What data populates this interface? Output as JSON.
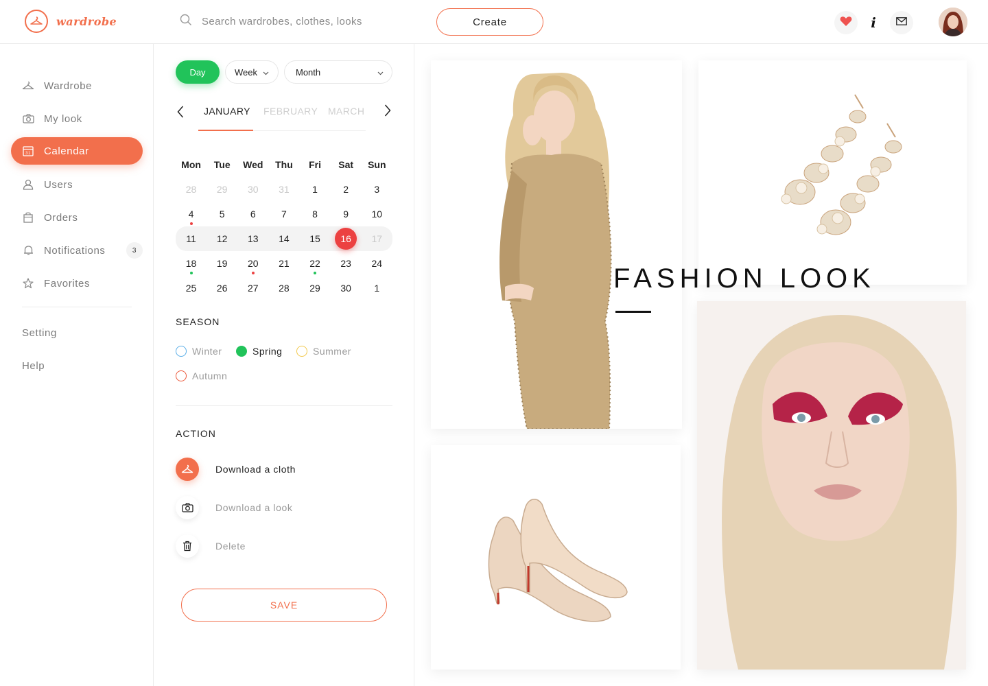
{
  "header": {
    "logo_text": "wardrobe",
    "search_placeholder": "Search wardrobes, clothes, looks",
    "create_label": "Create",
    "icons": [
      "heart-icon",
      "info-icon",
      "mail-icon"
    ]
  },
  "sidebar": {
    "items": [
      {
        "label": "Wardrobe",
        "icon": "hanger-icon"
      },
      {
        "label": "My look",
        "icon": "camera-icon"
      },
      {
        "label": "Calendar",
        "icon": "calendar-icon",
        "active": true
      },
      {
        "label": "Users",
        "icon": "user-icon"
      },
      {
        "label": "Orders",
        "icon": "bag-icon"
      },
      {
        "label": "Notifications",
        "icon": "bell-icon",
        "badge": "3"
      },
      {
        "label": "Favorites",
        "icon": "star-icon"
      }
    ],
    "setting_label": "Setting",
    "help_label": "Help"
  },
  "panel": {
    "view_day": "Day",
    "view_week": "Week",
    "view_month": "Month",
    "months": [
      "JANUARY",
      "FEBRUARY",
      "MARCH"
    ],
    "active_month": "JANUARY",
    "weekdays": [
      "Mon",
      "Tue",
      "Wed",
      "Thu",
      "Fri",
      "Sat",
      "Sun"
    ],
    "weeks": [
      [
        "28",
        "29",
        "30",
        "31",
        "1",
        "2",
        "3"
      ],
      [
        "4",
        "5",
        "6",
        "7",
        "8",
        "9",
        "10"
      ],
      [
        "11",
        "12",
        "13",
        "14",
        "15",
        "16",
        "17"
      ],
      [
        "18",
        "19",
        "20",
        "21",
        "22",
        "23",
        "24"
      ],
      [
        "25",
        "26",
        "27",
        "28",
        "29",
        "30",
        "1"
      ]
    ],
    "today": "16",
    "season_title": "SEASON",
    "seasons": [
      {
        "label": "Winter",
        "color": "#5aaee8"
      },
      {
        "label": "Spring",
        "color": "#21c35a",
        "selected": true
      },
      {
        "label": "Summer",
        "color": "#f2c94c"
      },
      {
        "label": "Autumn",
        "color": "#ec5a3c"
      }
    ],
    "action_title": "ACTION",
    "actions": [
      {
        "label": "Download a cloth",
        "icon": "hanger-icon"
      },
      {
        "label": "Download a look",
        "icon": "camera-icon"
      },
      {
        "label": "Delete",
        "icon": "trash-icon"
      }
    ],
    "save_label": "SAVE"
  },
  "content": {
    "title": "FASHION LOOK"
  },
  "colors": {
    "accent": "#f26f4c",
    "green": "#21c35a",
    "today": "#ec4141"
  }
}
